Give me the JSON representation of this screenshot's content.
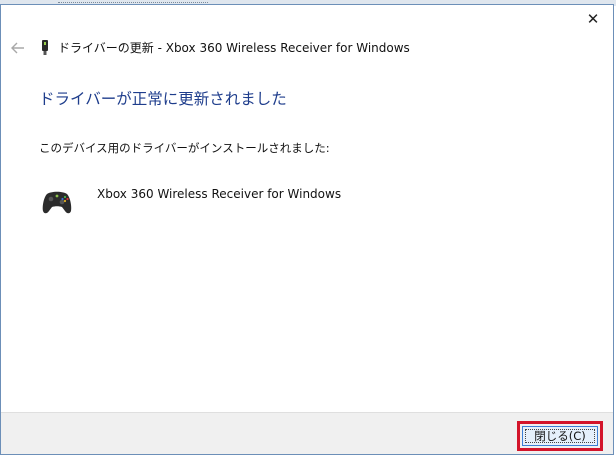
{
  "dialog": {
    "title": "ドライバーの更新 - Xbox 360 Wireless Receiver for Windows",
    "heading": "ドライバーが正常に更新されました",
    "instruction": "このデバイス用のドライバーがインストールされました:",
    "device_name": "Xbox 360 Wireless Receiver for Windows",
    "close_button_label": "閉じる(C)",
    "close_glyph": "✕",
    "back_glyph": "←"
  },
  "icons": {
    "back": "back-arrow-icon",
    "header_device": "usb-receiver-icon",
    "device": "game-controller-icon",
    "window_close": "close-icon"
  },
  "colors": {
    "heading": "#1e3d8c",
    "window_border": "#6c8fb8",
    "highlight": "#d3142a",
    "button_border": "#3c7fd4",
    "button_bg": "#e5f0fb",
    "footer_bg": "#f0f0f0"
  }
}
